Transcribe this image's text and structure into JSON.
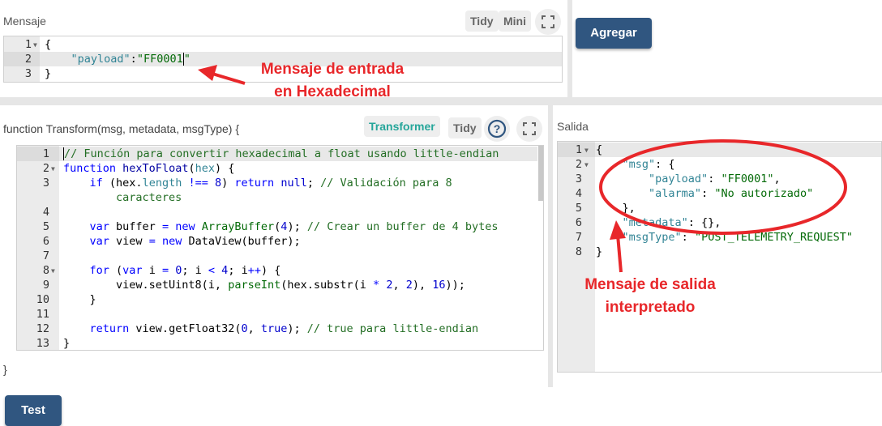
{
  "input_panel": {
    "title": "Mensaje",
    "tidy_label": "Tidy",
    "mini_label": "Mini",
    "lines": [
      "1",
      "2",
      "3"
    ],
    "code": [
      "{",
      "    \"payload\":\"FF0001\"",
      "}"
    ]
  },
  "add_button": {
    "label": "Agregar"
  },
  "function_panel": {
    "signature": "function Transform(msg, metadata, msgType) {",
    "closing": "}",
    "transformer_label": "Transformer",
    "tidy_label": "Tidy",
    "lines": [
      "1",
      "2",
      "3",
      "",
      "4",
      "5",
      "6",
      "7",
      "8",
      "9",
      "10",
      "11",
      "12",
      "13"
    ]
  },
  "output_panel": {
    "title": "Salida",
    "lines": [
      "1",
      "2",
      "3",
      "4",
      "5",
      "6",
      "7",
      "8"
    ]
  },
  "test_button": {
    "label": "Test"
  },
  "annotations": {
    "input_note_line1": "Mensaje de entrada",
    "input_note_line2": "en Hexadecimal",
    "output_note_line1": "Mensaje de salida",
    "output_note_line2": "interpretado"
  },
  "colors": {
    "primary": "#305680",
    "transformer_text": "#26a69a",
    "annotation": "#e8272a"
  },
  "icons": [
    "fullscreen-icon",
    "help-icon",
    "fold-arrow-icon",
    "arrow-icon",
    "ellipse-highlight"
  ]
}
